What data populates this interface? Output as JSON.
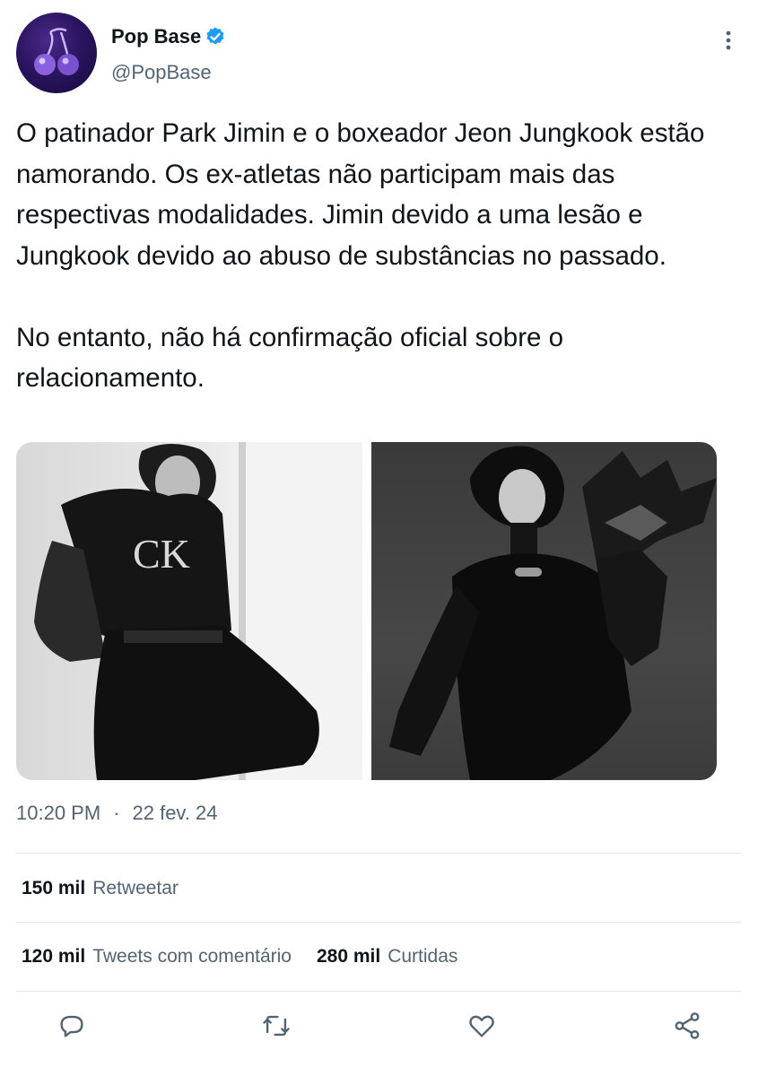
{
  "author": {
    "display_name": "Pop Base",
    "handle": "@PopBase",
    "avatar_icon": "cherries-icon",
    "verified_icon": "verified-badge-icon",
    "verified_color": "#1d9bf0"
  },
  "tweet": {
    "text": "O patinador Park Jimin e o boxeador Jeon Jungkook estão namorando. Os ex-atletas não participam mais das respectivas modalidades. Jimin devido a uma lesão e Jungkook devido ao abuso de substâncias no passado.\n\nNo entanto, não há confirmação oficial sobre o relacionamento.",
    "time": "10:20 PM",
    "separator": "·",
    "date": "22 fev. 24"
  },
  "stats": {
    "retweets_count": "150 mil",
    "retweets_label": "Retweetar",
    "quotes_count": "120 mil",
    "quotes_label": "Tweets com comentário",
    "likes_count": "280 mil",
    "likes_label": "Curtidas"
  },
  "actions": {
    "reply_icon": "reply-icon",
    "retweet_icon": "retweet-icon",
    "like_icon": "heart-icon",
    "share_icon": "share-icon"
  },
  "colors": {
    "text": "#0f1419",
    "secondary": "#536471",
    "divider": "#e1e6ea"
  }
}
